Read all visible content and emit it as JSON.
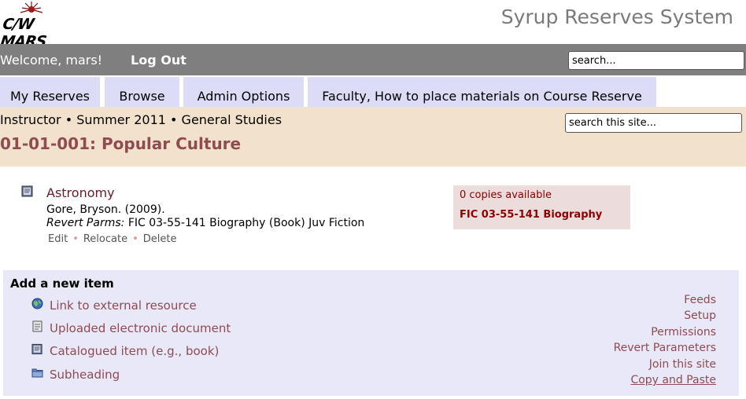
{
  "header": {
    "logo_text": "C/W MARS",
    "system_title": "Syrup Reserves System"
  },
  "topbar": {
    "welcome": "Welcome, mars!",
    "logout_label": "Log Out",
    "search_value": "search..."
  },
  "tabs": [
    {
      "label": "My Reserves"
    },
    {
      "label": "Browse"
    },
    {
      "label": "Admin Options"
    },
    {
      "label": "Faculty, How to place materials on Course Reserve"
    }
  ],
  "course": {
    "breadcrumb": "Instructor • Summer 2011 • General Studies",
    "title": "01-01-001: Popular Culture",
    "site_search_value": "search this site..."
  },
  "item": {
    "title": "Astronomy",
    "author": "Gore, Bryson. (2009).",
    "parms_label": "Revert Parms:",
    "parms_value": "FIC 03-55-141 Biography (Book) Juv Fiction",
    "actions": {
      "edit": "Edit",
      "relocate": "Relocate",
      "delete": "Delete"
    },
    "availability": "0 copies available",
    "call_number": "FIC 03-55-141 Biography"
  },
  "add_item": {
    "heading": "Add a new item",
    "links": [
      {
        "label": "Link to external resource",
        "icon": "globe-icon"
      },
      {
        "label": "Uploaded electronic document",
        "icon": "document-icon"
      },
      {
        "label": "Catalogued item (e.g., book)",
        "icon": "book-icon"
      },
      {
        "label": "Subheading",
        "icon": "folder-icon"
      }
    ]
  },
  "side_links": [
    {
      "label": "Feeds"
    },
    {
      "label": "Setup"
    },
    {
      "label": "Permissions"
    },
    {
      "label": "Revert Parameters"
    },
    {
      "label": "Join this site"
    },
    {
      "label": "Copy and Paste"
    }
  ],
  "colors": {
    "topbar": "#7f7f7f",
    "tab": "#dcdcf6",
    "course_band": "#f2e1cb",
    "link": "#8e4b50",
    "availability_bg": "#ecdcdc",
    "add_box": "#e8e8f8"
  }
}
